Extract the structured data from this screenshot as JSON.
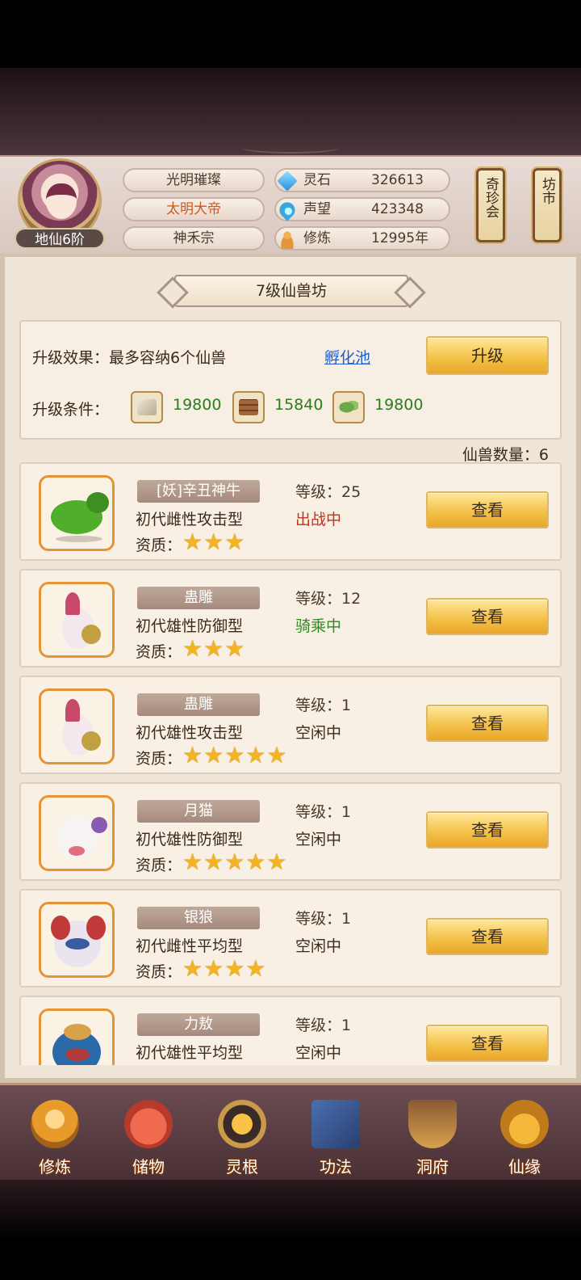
{
  "player": {
    "realm": "地仙6阶",
    "name": "光明璀璨",
    "title": "太明大帝",
    "sect": "神禾宗"
  },
  "resources": [
    {
      "label": "灵石",
      "value": "326613",
      "icon": "spirit-stone-icon"
    },
    {
      "label": "声望",
      "value": "423348",
      "icon": "reputation-icon"
    },
    {
      "label": "修炼",
      "value": "12995年",
      "icon": "meditation-icon"
    }
  ],
  "side_buttons": {
    "treasure": "奇珍会",
    "market": "坊市"
  },
  "panel": {
    "title": "7级仙兽坊",
    "effect_label": "升级效果：",
    "effect_text": "最多容纳6个仙兽",
    "hatch_link": "孵化池",
    "upgrade_button": "升级",
    "cond_label": "升级条件：",
    "materials": [
      {
        "icon": "scroll-material-icon",
        "value": "19800"
      },
      {
        "icon": "wood-material-icon",
        "value": "15840"
      },
      {
        "icon": "herb-material-icon",
        "value": "19800"
      }
    ],
    "count_label": "仙兽数量：6"
  },
  "beasts": [
    {
      "name": "[妖]辛丑神牛",
      "type": "初代雌性攻击型",
      "aptitude_label": "资质：",
      "stars": "★★★",
      "star_count": 3,
      "level": "等级：25",
      "status": "出战中",
      "status_color": "#c2321f",
      "view": "查看"
    },
    {
      "name": "蛊雕",
      "type": "初代雄性防御型",
      "aptitude_label": "资质：",
      "stars": "★★★",
      "star_count": 3,
      "level": "等级：12",
      "status": "骑乘中",
      "status_color": "#2e8a22",
      "view": "查看"
    },
    {
      "name": "蛊雕",
      "type": "初代雄性攻击型",
      "aptitude_label": "资质：",
      "stars": "★★★★★",
      "star_count": 5,
      "level": "等级：1",
      "status": "空闲中",
      "status_color": "#3a2a1a",
      "view": "查看"
    },
    {
      "name": "月猫",
      "type": "初代雄性防御型",
      "aptitude_label": "资质：",
      "stars": "★★★★★",
      "star_count": 5,
      "level": "等级：1",
      "status": "空闲中",
      "status_color": "#3a2a1a",
      "view": "查看"
    },
    {
      "name": "银狼",
      "type": "初代雌性平均型",
      "aptitude_label": "资质：",
      "stars": "★★★★",
      "star_count": 4,
      "level": "等级：1",
      "status": "空闲中",
      "status_color": "#3a2a1a",
      "view": "查看"
    },
    {
      "name": "力敖",
      "type": "初代雄性平均型",
      "aptitude_label": "",
      "stars": "",
      "star_count": 0,
      "level": "等级：1",
      "status": "空闲中",
      "status_color": "#3a2a1a",
      "view": "查看"
    }
  ],
  "nav": [
    {
      "label": "修炼",
      "icon": "cultivation-icon"
    },
    {
      "label": "储物",
      "icon": "storage-bag-icon"
    },
    {
      "label": "灵根",
      "icon": "spirit-root-icon"
    },
    {
      "label": "功法",
      "icon": "technique-book-icon"
    },
    {
      "label": "洞府",
      "icon": "cave-dwelling-icon"
    },
    {
      "label": "仙缘",
      "icon": "immortal-fate-icon"
    }
  ]
}
